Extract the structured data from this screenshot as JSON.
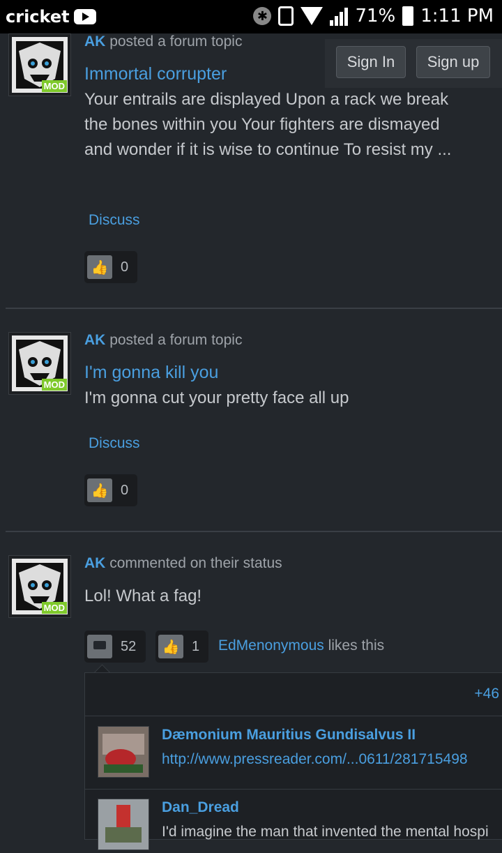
{
  "status_bar": {
    "carrier": "cricket",
    "battery": "71%",
    "time": "1:11 PM"
  },
  "auth": {
    "sign_in": "Sign In",
    "sign_up": "Sign up"
  },
  "posts": [
    {
      "user": "AK",
      "action": "posted a forum topic",
      "badge": "MOD",
      "title": "Immortal corrupter",
      "body": "Your entrails are displayed Upon a rack we break the bones within you Your fighters are dismayed and wonder if it is wise to continue To resist my ...",
      "discuss": "Discuss",
      "likes": "0"
    },
    {
      "user": "AK",
      "action": "posted a forum topic",
      "badge": "MOD",
      "title": "I'm gonna kill you",
      "body": "I'm gonna cut your pretty face all up",
      "discuss": "Discuss",
      "likes": "0"
    },
    {
      "user": "AK",
      "action": "commented on their status",
      "badge": "MOD",
      "body": "Lol! What a fag!",
      "comments_count": "52",
      "likes": "1",
      "liked_by": "EdMenonymous",
      "liked_by_suffix": "likes this",
      "more_comments": "+46",
      "comments": [
        {
          "user": "Dæmonium Mauritius Gundisalvus II",
          "text": "http://www.pressreader.com/...0611/281715498"
        },
        {
          "user": "Dan_Dread",
          "text": "I'd imagine the man that invented the mental hospi"
        }
      ]
    }
  ],
  "colors": {
    "link": "#4a9fe0",
    "mod_badge": "#7fc92b",
    "background": "#23272c"
  }
}
